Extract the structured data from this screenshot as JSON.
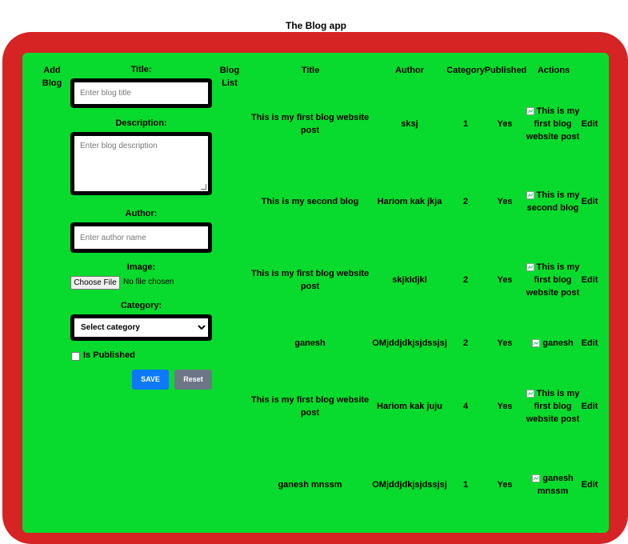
{
  "app": {
    "title": "The Blog app"
  },
  "form": {
    "heading": "Add Blog",
    "title_label": "Title:",
    "title_placeholder": "Enter blog title",
    "description_label": "Description:",
    "description_placeholder": "Enter blog description",
    "author_label": "Author:",
    "author_placeholder": "Enter author name",
    "image_label": "Image:",
    "file_button": "Choose File",
    "file_status": "No file chosen",
    "category_label": "Category:",
    "category_selected": "Select category",
    "published_label": "Is Published",
    "save_label": "SAVE",
    "reset_label": "Reset"
  },
  "list": {
    "heading": "Blog List",
    "columns": [
      "Title",
      "Author",
      "Category",
      "Published",
      "Actions"
    ],
    "edit_label": "Edit",
    "rows": [
      {
        "title": "This is my first blog website post",
        "author": "sksj",
        "category": "1",
        "published": "Yes",
        "image_alt": "This is my first blog website post"
      },
      {
        "title": "This is my second blog",
        "author": "Hariom kak jkja",
        "category": "2",
        "published": "Yes",
        "image_alt": "This is my second blog"
      },
      {
        "title": "This is my first blog website post",
        "author": "skjkldjkl",
        "category": "2",
        "published": "Yes",
        "image_alt": "This is my first blog website post"
      },
      {
        "title": "ganesh",
        "author": "OMjddjdkjsjdssjsj",
        "category": "2",
        "published": "Yes",
        "image_alt": "ganesh"
      },
      {
        "title": "This is my first blog website post",
        "author": "Hariom kak juju",
        "category": "4",
        "published": "Yes",
        "image_alt": "This is my first blog website post"
      },
      {
        "title": "ganesh mnssm",
        "author": "OMjddjdkjsjdssjsj",
        "category": "1",
        "published": "Yes",
        "image_alt": "ganesh mnssm"
      }
    ]
  },
  "colors": {
    "frame": "#d62324",
    "panel": "#08db2d",
    "save": "#0d79f8",
    "reset": "#6d7687"
  }
}
